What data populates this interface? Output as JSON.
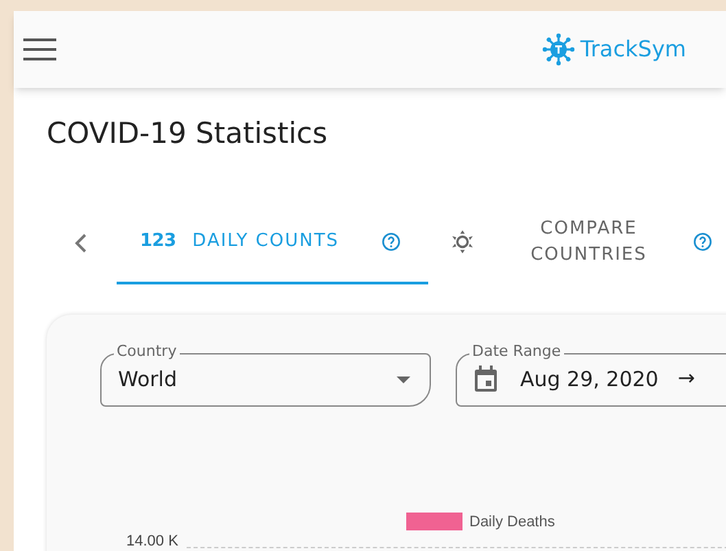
{
  "app_bar": {
    "brand": "TrackSym"
  },
  "page_title": "COVID-19 Statistics",
  "tabs": [
    {
      "kind": "numbers",
      "icon_text": "123",
      "label": "DAILY COUNTS",
      "selected": true
    },
    {
      "kind": "compare",
      "label": "COMPARE COUNTRIES",
      "selected": false
    }
  ],
  "filters": {
    "country": {
      "label": "Country",
      "value": "World"
    },
    "date_range": {
      "label": "Date Range",
      "value": "Aug 29, 2020",
      "separator": "→"
    }
  },
  "chart": {
    "legend": [
      {
        "name": "Daily Deaths",
        "color": "#f06292"
      }
    ],
    "y_tick": "14.00 K"
  }
}
